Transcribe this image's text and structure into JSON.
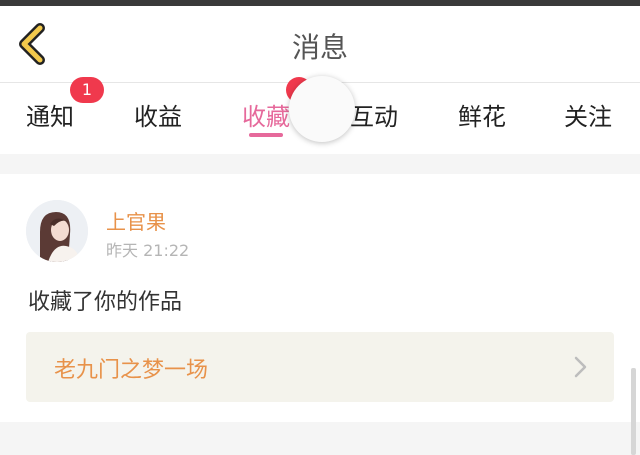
{
  "header": {
    "title": "消息",
    "back_icon": "chevron-left-icon",
    "back_color": "#f2c94c"
  },
  "tabs": [
    {
      "label": "通知",
      "badge": "1"
    },
    {
      "label": "收益"
    },
    {
      "label": "收藏",
      "active": true
    },
    {
      "label": "互动"
    },
    {
      "label": "鲜花"
    },
    {
      "label": "关注"
    }
  ],
  "accent_color": "#e6699b",
  "message": {
    "user_name": "上官果",
    "time": "昨天 21:22",
    "action": "收藏了你的作品",
    "work_title": "老九门之梦一场",
    "link_icon": "chevron-right-icon"
  }
}
